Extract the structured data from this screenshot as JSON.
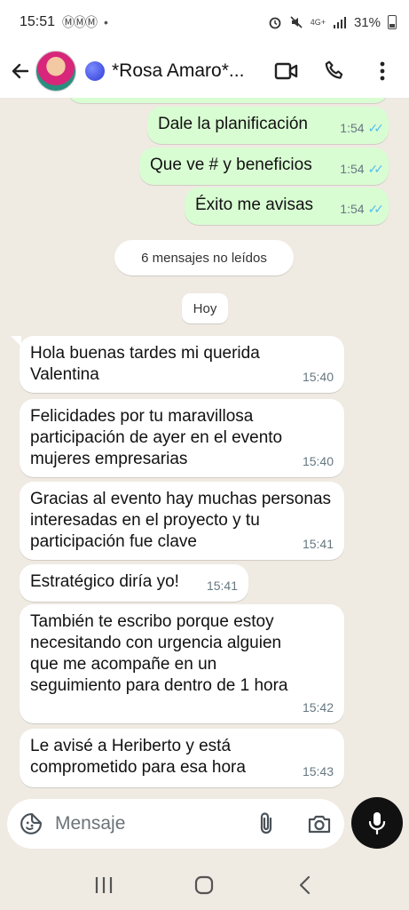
{
  "status_bar": {
    "time": "15:51",
    "left_icons": "ⓂⓂⓂ",
    "dot": "•",
    "network": "4G+",
    "battery": "31%"
  },
  "header": {
    "contact_name": "*Rosa Amaro*..."
  },
  "messages_top": [
    {
      "text": "Dale la planificación",
      "time": "1:54"
    },
    {
      "text": "Que ve # y beneficios",
      "time": "1:54"
    },
    {
      "text": "Éxito me avisas",
      "time": "1:54"
    }
  ],
  "unread_label": "6 mensajes no leídos",
  "date_label": "Hoy",
  "messages_in": [
    {
      "text": "Hola buenas tardes mi querida Valentina",
      "time": "15:40"
    },
    {
      "text": "Felicidades por tu maravillosa participación de ayer en el evento mujeres empresarias",
      "time": "15:40"
    },
    {
      "text": "Gracias al evento hay muchas personas interesadas en el proyecto y tu participación fue clave",
      "time": "15:41"
    },
    {
      "text": "Estratégico diría yo!",
      "time": "15:41"
    },
    {
      "text": "También te escribo porque estoy necesitando con urgencia alguien que me acompañe en un seguimiento para dentro de 1 hora",
      "time": "15:42"
    },
    {
      "text": "Le avisé a Heriberto y está comprometido para esa hora",
      "time": "15:43"
    }
  ],
  "input": {
    "placeholder": "Mensaje"
  },
  "colors": {
    "chat_bg": "#efeae2",
    "outgoing_bubble": "#d9fdd3",
    "incoming_bubble": "#ffffff",
    "read_ticks": "#53bdeb"
  },
  "icons": [
    "back-arrow-icon",
    "video-call-icon",
    "phone-icon",
    "more-vert-icon",
    "sticker-icon",
    "attach-icon",
    "camera-icon",
    "mic-icon",
    "nav-recents-icon",
    "nav-home-icon",
    "nav-back-icon"
  ]
}
